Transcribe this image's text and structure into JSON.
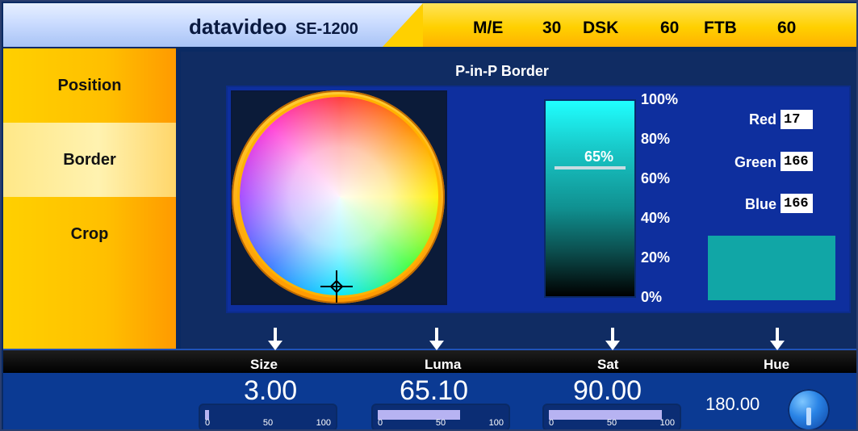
{
  "app": {
    "brand_primary": "datavideo",
    "brand_secondary": "SE-1200"
  },
  "header": {
    "status_items": [
      {
        "label": "M/E",
        "value": "30"
      },
      {
        "label": "DSK",
        "value": "60"
      },
      {
        "label": "FTB",
        "value": "60"
      }
    ]
  },
  "left_menu": {
    "items": [
      {
        "label": "Position",
        "active": false
      },
      {
        "label": "Border",
        "active": true
      },
      {
        "label": "Crop",
        "active": false
      }
    ]
  },
  "panel": {
    "title": "P-in-P Border",
    "luma_percent_label": "65%",
    "luma_scale": [
      "100%",
      "80%",
      "60%",
      "40%",
      "20%",
      "0%"
    ],
    "rgb": {
      "red_label": "Red",
      "green_label": "Green",
      "blue_label": "Blue",
      "red_value": "17",
      "green_value": "166",
      "blue_value": "166",
      "swatch_color": "#11a6a6"
    }
  },
  "bottom_controls": {
    "labels": [
      "Size",
      "Luma",
      "Sat",
      "Hue"
    ],
    "values": {
      "size": "3.00",
      "luma": "65.10",
      "sat": "90.00",
      "hue": "180.00"
    },
    "scale_ticks": [
      "0",
      "50",
      "100"
    ],
    "fill_fraction": {
      "size": 0.03,
      "luma": 0.651,
      "sat": 0.9
    }
  },
  "colors": {
    "accent_yellow": "#ffd000",
    "accent_orange": "#ff9a00",
    "panel_blue": "#0e2f9e"
  }
}
